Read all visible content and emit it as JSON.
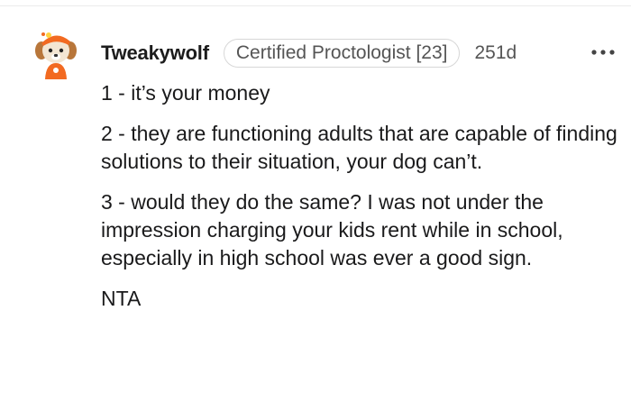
{
  "comment": {
    "username": "Tweakywolf",
    "flair": "Certified Proctologist [23]",
    "age": "251d",
    "paragraphs": [
      "1 - it’s your money",
      "2 - they are functioning adults that are capable of finding solutions to their situation, your dog can’t.",
      "3 - would they do the same? I was not under the impression charging your kids rent while in school, especially in high school was ever a good sign.",
      "NTA"
    ]
  },
  "icons": {
    "avatar": "avatar-dog-icon",
    "more": "more-options-icon"
  },
  "colors": {
    "text": "#1a1a1b",
    "muted": "#555555",
    "flair_border": "#d7d7d7",
    "avatar_accent": "#f26a21"
  }
}
